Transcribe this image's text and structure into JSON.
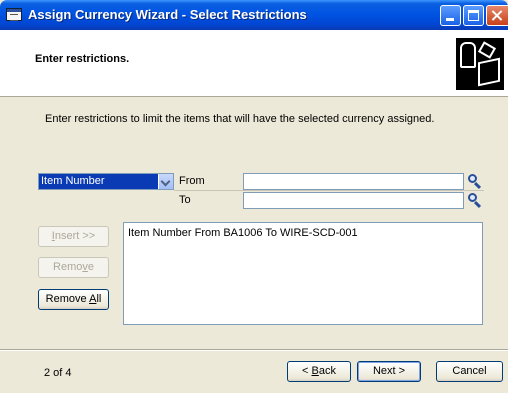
{
  "window": {
    "title": "Assign Currency Wizard - Select Restrictions"
  },
  "header": {
    "title": "Enter restrictions."
  },
  "instructions": "Enter restrictions to limit the items that will have the selected currency assigned.",
  "restriction": {
    "field_selected": "Item Number",
    "from_label": "From",
    "to_label": "To",
    "from_value": "",
    "to_value": ""
  },
  "buttons": {
    "insert_pre": "",
    "insert_acc": "I",
    "insert_post": "nsert >>",
    "remove_pre": "Remo",
    "remove_acc": "v",
    "remove_post": "e",
    "remove_all_pre": "Remove ",
    "remove_all_acc": "A",
    "remove_all_post": "ll"
  },
  "restrictions_list": [
    "Item Number From BA1006 To  WIRE-SCD-001"
  ],
  "footer": {
    "page_indicator": "2 of 4",
    "back_pre": "< ",
    "back_acc": "B",
    "back_post": "ack",
    "next_label": "Next >",
    "cancel_label": "Cancel"
  },
  "colors": {
    "titlebar": "#0054e3",
    "dialog_bg": "#ece9d8",
    "selection": "#0a3bb5",
    "field_border": "#7f9db9"
  },
  "icons": [
    "wizard-icon",
    "chevron-down-icon",
    "lookup-icon",
    "minimize-icon",
    "maximize-icon",
    "close-icon",
    "app-icon"
  ]
}
